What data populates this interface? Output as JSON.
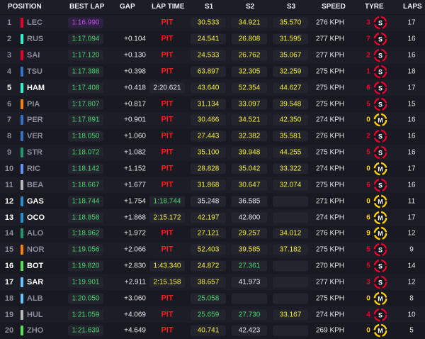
{
  "header": {
    "position": "POSITION",
    "best_lap": "BEST LAP",
    "gap": "GAP",
    "lap_time": "LAP TIME",
    "s1": "S1",
    "s2": "S2",
    "s3": "S3",
    "speed": "SPEED",
    "tyre": "TYRE",
    "laps": "LAPS"
  },
  "colors": {
    "purple": "#c34ee9",
    "green": "#49d46c",
    "yellow": "#f4f13a",
    "pit_red": "#ff1a1a",
    "soft_red": "#e8002d",
    "medium_yellow": "#ffd000"
  },
  "rows": [
    {
      "pos": "1",
      "code": "LEC",
      "team_color": "#e8002d",
      "active": false,
      "best": "1:16.990",
      "best_color": "purple",
      "gap": "",
      "lap": "PIT",
      "lap_color": "pit",
      "s1": "30.533",
      "s1c": "yellow",
      "s2": "34.921",
      "s2c": "yellow",
      "s3": "35.570",
      "s3c": "yellow",
      "speed": "276 KPH",
      "stops": "3",
      "tyre": "S",
      "tyre_icon": "soft-tyre-icon",
      "laps": "17"
    },
    {
      "pos": "2",
      "code": "RUS",
      "team_color": "#27f4d2",
      "active": false,
      "best": "1:17.094",
      "best_color": "green",
      "gap": "+0.104",
      "lap": "PIT",
      "lap_color": "pit",
      "s1": "24.541",
      "s1c": "yellow",
      "s2": "26.808",
      "s2c": "yellow",
      "s3": "31.595",
      "s3c": "yellow",
      "speed": "277 KPH",
      "stops": "7",
      "tyre": "S",
      "tyre_icon": "soft-tyre-icon",
      "laps": "16"
    },
    {
      "pos": "3",
      "code": "SAI",
      "team_color": "#e8002d",
      "active": false,
      "best": "1:17.120",
      "best_color": "green",
      "gap": "+0.130",
      "lap": "PIT",
      "lap_color": "pit",
      "s1": "24.533",
      "s1c": "yellow",
      "s2": "26.762",
      "s2c": "yellow",
      "s3": "35.067",
      "s3c": "yellow",
      "speed": "277 KPH",
      "stops": "2",
      "tyre": "S",
      "tyre_icon": "soft-tyre-icon",
      "laps": "16"
    },
    {
      "pos": "4",
      "code": "TSU",
      "team_color": "#3671c6",
      "active": false,
      "best": "1:17.388",
      "best_color": "green",
      "gap": "+0.398",
      "lap": "PIT",
      "lap_color": "pit",
      "s1": "63.897",
      "s1c": "yellow",
      "s2": "32.305",
      "s2c": "yellow",
      "s3": "32.259",
      "s3c": "yellow",
      "speed": "275 KPH",
      "stops": "1",
      "tyre": "S",
      "tyre_icon": "soft-tyre-icon",
      "laps": "18"
    },
    {
      "pos": "5",
      "code": "HAM",
      "team_color": "#27f4d2",
      "active": true,
      "best": "1:17.408",
      "best_color": "green",
      "gap": "+0.418",
      "lap": "2:20.621",
      "lap_color": "white",
      "s1": "43.640",
      "s1c": "yellow",
      "s2": "52.354",
      "s2c": "yellow",
      "s3": "44.627",
      "s3c": "yellow",
      "speed": "275 KPH",
      "stops": "6",
      "tyre": "S",
      "tyre_icon": "soft-tyre-icon",
      "laps": "17"
    },
    {
      "pos": "6",
      "code": "PIA",
      "team_color": "#ff8000",
      "active": false,
      "best": "1:17.807",
      "best_color": "green",
      "gap": "+0.817",
      "lap": "PIT",
      "lap_color": "pit",
      "s1": "31.134",
      "s1c": "yellow",
      "s2": "33.097",
      "s2c": "yellow",
      "s3": "39.548",
      "s3c": "yellow",
      "speed": "275 KPH",
      "stops": "5",
      "tyre": "S",
      "tyre_icon": "soft-tyre-icon",
      "laps": "15"
    },
    {
      "pos": "7",
      "code": "PER",
      "team_color": "#3671c6",
      "active": false,
      "best": "1:17.891",
      "best_color": "green",
      "gap": "+0.901",
      "lap": "PIT",
      "lap_color": "pit",
      "s1": "30.466",
      "s1c": "yellow",
      "s2": "34.521",
      "s2c": "yellow",
      "s3": "42.350",
      "s3c": "yellow",
      "speed": "274 KPH",
      "stops": "0",
      "tyre": "M",
      "tyre_icon": "medium-tyre-icon",
      "laps": "16"
    },
    {
      "pos": "8",
      "code": "VER",
      "team_color": "#3671c6",
      "active": false,
      "best": "1:18.050",
      "best_color": "green",
      "gap": "+1.060",
      "lap": "PIT",
      "lap_color": "pit",
      "s1": "27.443",
      "s1c": "yellow",
      "s2": "32.382",
      "s2c": "yellow",
      "s3": "35.581",
      "s3c": "yellow",
      "speed": "276 KPH",
      "stops": "2",
      "tyre": "S",
      "tyre_icon": "soft-tyre-icon",
      "laps": "16"
    },
    {
      "pos": "9",
      "code": "STR",
      "team_color": "#229971",
      "active": false,
      "best": "1:18.072",
      "best_color": "green",
      "gap": "+1.082",
      "lap": "PIT",
      "lap_color": "pit",
      "s1": "35.100",
      "s1c": "yellow",
      "s2": "39.948",
      "s2c": "yellow",
      "s3": "44.255",
      "s3c": "yellow",
      "speed": "275 KPH",
      "stops": "5",
      "tyre": "S",
      "tyre_icon": "soft-tyre-icon",
      "laps": "16"
    },
    {
      "pos": "10",
      "code": "RIC",
      "team_color": "#6692ff",
      "active": false,
      "best": "1:18.142",
      "best_color": "green",
      "gap": "+1.152",
      "lap": "PIT",
      "lap_color": "pit",
      "s1": "28.828",
      "s1c": "yellow",
      "s2": "35.042",
      "s2c": "yellow",
      "s3": "33.322",
      "s3c": "yellow",
      "speed": "274 KPH",
      "stops": "0",
      "tyre": "M",
      "tyre_icon": "medium-tyre-icon",
      "laps": "17"
    },
    {
      "pos": "11",
      "code": "BEA",
      "team_color": "#b6babd",
      "active": false,
      "best": "1:18.667",
      "best_color": "green",
      "gap": "+1.677",
      "lap": "PIT",
      "lap_color": "pit",
      "s1": "31.868",
      "s1c": "yellow",
      "s2": "30.647",
      "s2c": "yellow",
      "s3": "32.074",
      "s3c": "yellow",
      "speed": "275 KPH",
      "stops": "6",
      "tyre": "S",
      "tyre_icon": "soft-tyre-icon",
      "laps": "16"
    },
    {
      "pos": "12",
      "code": "GAS",
      "team_color": "#2293d1",
      "active": true,
      "best": "1:18.744",
      "best_color": "green",
      "gap": "+1.754",
      "lap": "1:18.744",
      "lap_color": "green",
      "s1": "35.248",
      "s1c": "white",
      "s2": "36.585",
      "s2c": "white",
      "s3": "",
      "s3c": "empty",
      "speed": "271 KPH",
      "stops": "0",
      "tyre": "M",
      "tyre_icon": "medium-tyre-icon",
      "laps": "11"
    },
    {
      "pos": "13",
      "code": "OCO",
      "team_color": "#2293d1",
      "active": true,
      "best": "1:18.858",
      "best_color": "green",
      "gap": "+1.868",
      "lap": "2:15.172",
      "lap_color": "yellow",
      "s1": "42.197",
      "s1c": "yellow",
      "s2": "42.800",
      "s2c": "white",
      "s3": "",
      "s3c": "empty",
      "speed": "274 KPH",
      "stops": "6",
      "tyre": "M",
      "tyre_icon": "medium-tyre-icon",
      "laps": "17"
    },
    {
      "pos": "14",
      "code": "ALO",
      "team_color": "#229971",
      "active": false,
      "best": "1:18.962",
      "best_color": "green",
      "gap": "+1.972",
      "lap": "PIT",
      "lap_color": "pit",
      "s1": "27.121",
      "s1c": "yellow",
      "s2": "29.257",
      "s2c": "yellow",
      "s3": "34.012",
      "s3c": "yellow",
      "speed": "276 KPH",
      "stops": "9",
      "tyre": "M",
      "tyre_icon": "medium-tyre-icon",
      "laps": "12"
    },
    {
      "pos": "15",
      "code": "NOR",
      "team_color": "#ff8000",
      "active": false,
      "best": "1:19.056",
      "best_color": "green",
      "gap": "+2.066",
      "lap": "PIT",
      "lap_color": "pit",
      "s1": "52.403",
      "s1c": "yellow",
      "s2": "39.585",
      "s2c": "yellow",
      "s3": "37.182",
      "s3c": "yellow",
      "speed": "275 KPH",
      "stops": "5",
      "tyre": "S",
      "tyre_icon": "soft-tyre-icon",
      "laps": "9"
    },
    {
      "pos": "16",
      "code": "BOT",
      "team_color": "#52e252",
      "active": true,
      "best": "1:19.820",
      "best_color": "green",
      "gap": "+2.830",
      "lap": "1:43.340",
      "lap_color": "yellow",
      "s1": "24.872",
      "s1c": "yellow",
      "s2": "27.361",
      "s2c": "green",
      "s3": "",
      "s3c": "empty",
      "speed": "270 KPH",
      "stops": "5",
      "tyre": "S",
      "tyre_icon": "soft-tyre-icon",
      "laps": "14"
    },
    {
      "pos": "17",
      "code": "SAR",
      "team_color": "#64c4ff",
      "active": true,
      "best": "1:19.901",
      "best_color": "green",
      "gap": "+2.911",
      "lap": "2:15.158",
      "lap_color": "yellow",
      "s1": "38.657",
      "s1c": "yellow",
      "s2": "41.973",
      "s2c": "white",
      "s3": "",
      "s3c": "empty",
      "speed": "277 KPH",
      "stops": "3",
      "tyre": "S",
      "tyre_icon": "soft-tyre-icon",
      "laps": "12"
    },
    {
      "pos": "18",
      "code": "ALB",
      "team_color": "#64c4ff",
      "active": false,
      "best": "1:20.050",
      "best_color": "green",
      "gap": "+3.060",
      "lap": "PIT",
      "lap_color": "pit",
      "s1": "25.058",
      "s1c": "green",
      "s2": "",
      "s2c": "empty",
      "s3": "",
      "s3c": "empty",
      "speed": "275 KPH",
      "stops": "0",
      "tyre": "M",
      "tyre_icon": "medium-tyre-icon",
      "laps": "8"
    },
    {
      "pos": "19",
      "code": "HUL",
      "team_color": "#b6babd",
      "active": false,
      "best": "1:21.059",
      "best_color": "green",
      "gap": "+4.069",
      "lap": "PIT",
      "lap_color": "pit",
      "s1": "25.659",
      "s1c": "green",
      "s2": "27.730",
      "s2c": "green",
      "s3": "33.167",
      "s3c": "yellow",
      "speed": "274 KPH",
      "stops": "4",
      "tyre": "S",
      "tyre_icon": "soft-tyre-icon",
      "laps": "10"
    },
    {
      "pos": "20",
      "code": "ZHO",
      "team_color": "#52e252",
      "active": false,
      "best": "1:21.639",
      "best_color": "green",
      "gap": "+4.649",
      "lap": "PIT",
      "lap_color": "pit",
      "s1": "40.741",
      "s1c": "yellow",
      "s2": "42.423",
      "s2c": "white",
      "s3": "",
      "s3c": "empty",
      "speed": "269 KPH",
      "stops": "0",
      "tyre": "M",
      "tyre_icon": "medium-tyre-icon",
      "laps": "5"
    }
  ]
}
